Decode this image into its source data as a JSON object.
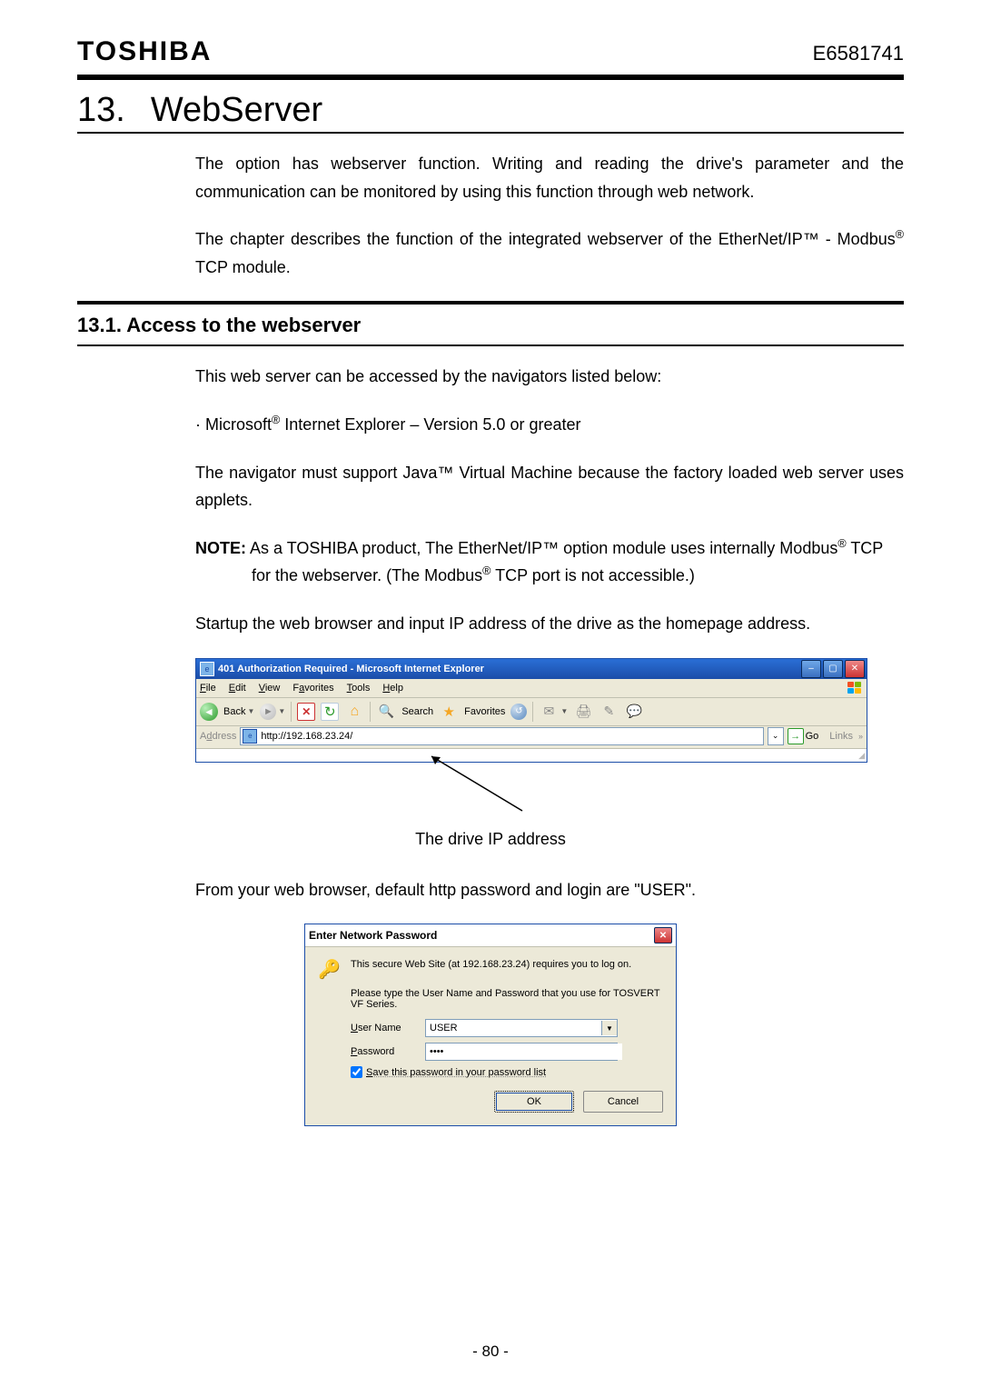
{
  "header": {
    "brand": "TOSHIBA",
    "docnum": "E6581741"
  },
  "h1": {
    "num": "13.",
    "title": "WebServer"
  },
  "para1": "The option has webserver function. Writing and reading the drive's parameter and the communication can be monitored by using this function through web network.",
  "para2_a": "The chapter describes the function of the integrated webserver of the EtherNet/IP™ - Modbus",
  "para2_b": " TCP module.",
  "h2": "13.1. Access to the webserver",
  "para3": "This web server can be accessed by the navigators listed below:",
  "bullet_a": "· Microsoft",
  "bullet_b": " Internet Explorer – Version 5.0 or greater",
  "para4": "The navigator must support Java™ Virtual Machine because the factory loaded web server uses applets.",
  "note": {
    "label": "NOTE:",
    "line1_a": " As a TOSHIBA product, The EtherNet/IP™ option module uses internally Modbus",
    "line1_b": " TCP",
    "line2_a": "for the webserver. (The Modbus",
    "line2_b": " TCP port is not accessible.)"
  },
  "para5": "Startup the web browser and input IP address of the drive as the homepage address.",
  "ie": {
    "title": "401 Authorization Required - Microsoft Internet Explorer",
    "menus": {
      "file": "File",
      "edit": "Edit",
      "view": "View",
      "favorites": "Favorites",
      "tools": "Tools",
      "help": "Help"
    },
    "back": "Back",
    "search": "Search",
    "favlabel": "Favorites",
    "addr_label": "Address",
    "url": "http://192.168.23.24/",
    "go": "Go",
    "links": "Links"
  },
  "caption": "The drive IP address",
  "para6": "From your web browser, default http password and login are \"USER\".",
  "dialog": {
    "title": "Enter Network Password",
    "msg1": "This secure Web Site (at 192.168.23.24) requires you to log on.",
    "msg2": "Please type the User Name and Password that you use for TOSVERT VF Series.",
    "user_label": "User Name",
    "user_value": "USER",
    "pass_label": "Password",
    "pass_value": "••••",
    "save": "Save this password in your password list",
    "ok": "OK",
    "cancel": "Cancel"
  },
  "pagenum": "- 80 -"
}
